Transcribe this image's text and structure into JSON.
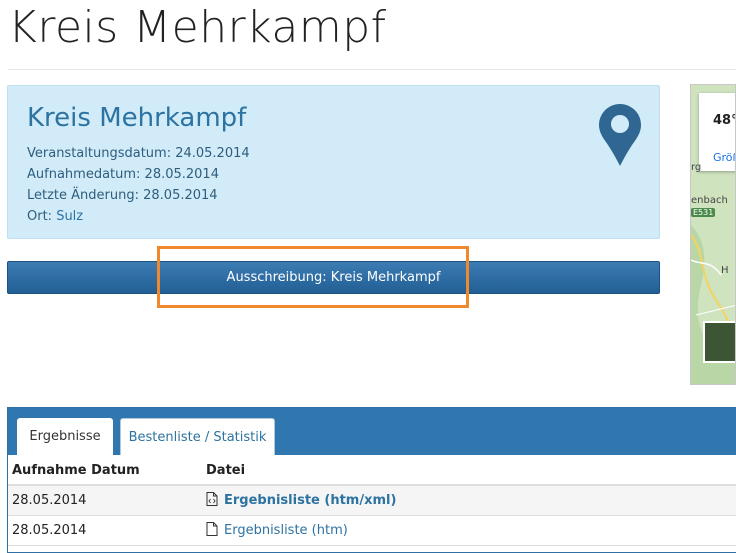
{
  "page": {
    "title": "Kreis Mehrkampf"
  },
  "event": {
    "title": "Kreis Mehrkampf",
    "event_date": "Veranstaltungsdatum: 24.05.2014",
    "record_date": "Aufnahmedatum: 28.05.2014",
    "last_change": "Letzte Änderung: 28.05.2014",
    "location_label": "Ort: ",
    "location_value": "Sulz",
    "icon": "map-marker-icon"
  },
  "tender_button": {
    "label": "Ausschreibung: Kreis Mehrkampf"
  },
  "map": {
    "coord": "48°",
    "link": "Größ",
    "labels": [
      "rg",
      "enbach",
      "E531",
      "H"
    ]
  },
  "results": {
    "tabs": [
      {
        "label": "Ergebnisse",
        "active": true
      },
      {
        "label": "Bestenliste / Statistik",
        "active": false
      }
    ],
    "columns": [
      "Aufnahme Datum",
      "Datei"
    ],
    "rows": [
      {
        "date": "28.05.2014",
        "file": "Ergebnisliste (htm/xml)",
        "icon": "code-file-icon",
        "bold": true
      },
      {
        "date": "28.05.2014",
        "file": "Ergebnisliste (htm)",
        "icon": "file-icon",
        "bold": false
      }
    ]
  },
  "colors": {
    "accent": "#3077b0",
    "info_bg": "#d1ecf8",
    "highlight": "#f0892c"
  }
}
